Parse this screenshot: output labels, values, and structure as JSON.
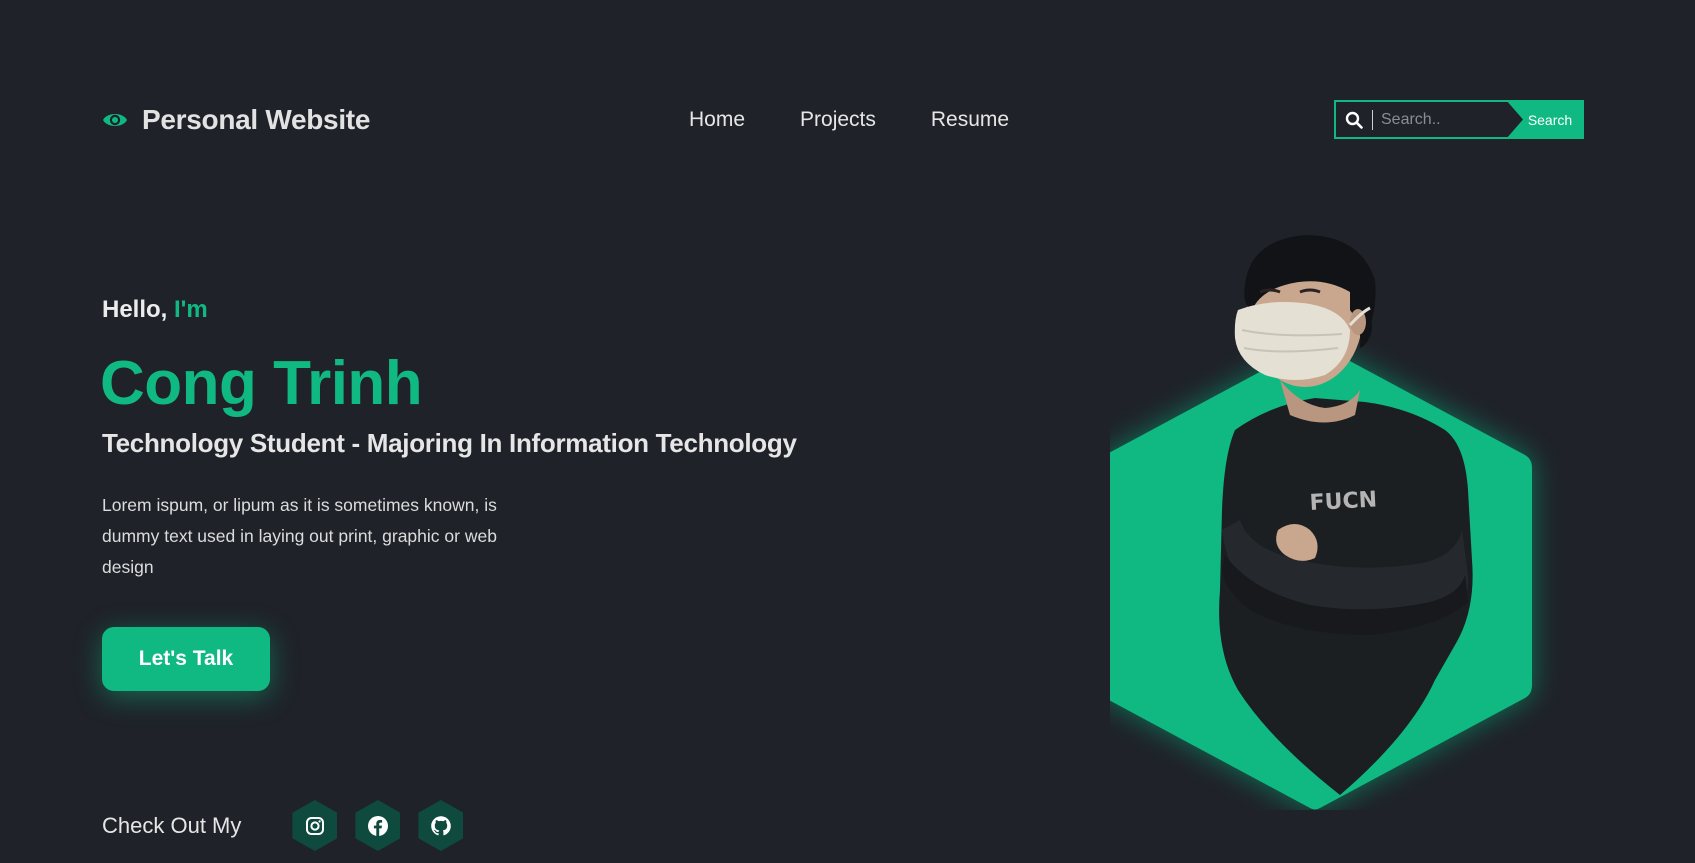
{
  "header": {
    "logo_text": "Personal Website",
    "nav": [
      {
        "label": "Home"
      },
      {
        "label": "Projects"
      },
      {
        "label": "Resume"
      }
    ],
    "search": {
      "placeholder": "Search..",
      "button_label": "Search"
    }
  },
  "hero": {
    "greeting": "Hello,",
    "greeting_accent": "I'm",
    "name": "Cong Trinh",
    "subtitle": "Technology Student - Majoring In Information Technology",
    "description": "Lorem ispum, or lipum as it is sometimes known, is dummy text used in laying out print, graphic or web design",
    "cta_label": "Let's Talk",
    "social_label": "Check Out My",
    "social": [
      {
        "icon": "instagram-icon"
      },
      {
        "icon": "facebook-icon"
      },
      {
        "icon": "github-icon"
      }
    ]
  },
  "colors": {
    "accent": "#10b981",
    "background": "#1f2229",
    "social_bg": "#0f4a3e"
  }
}
